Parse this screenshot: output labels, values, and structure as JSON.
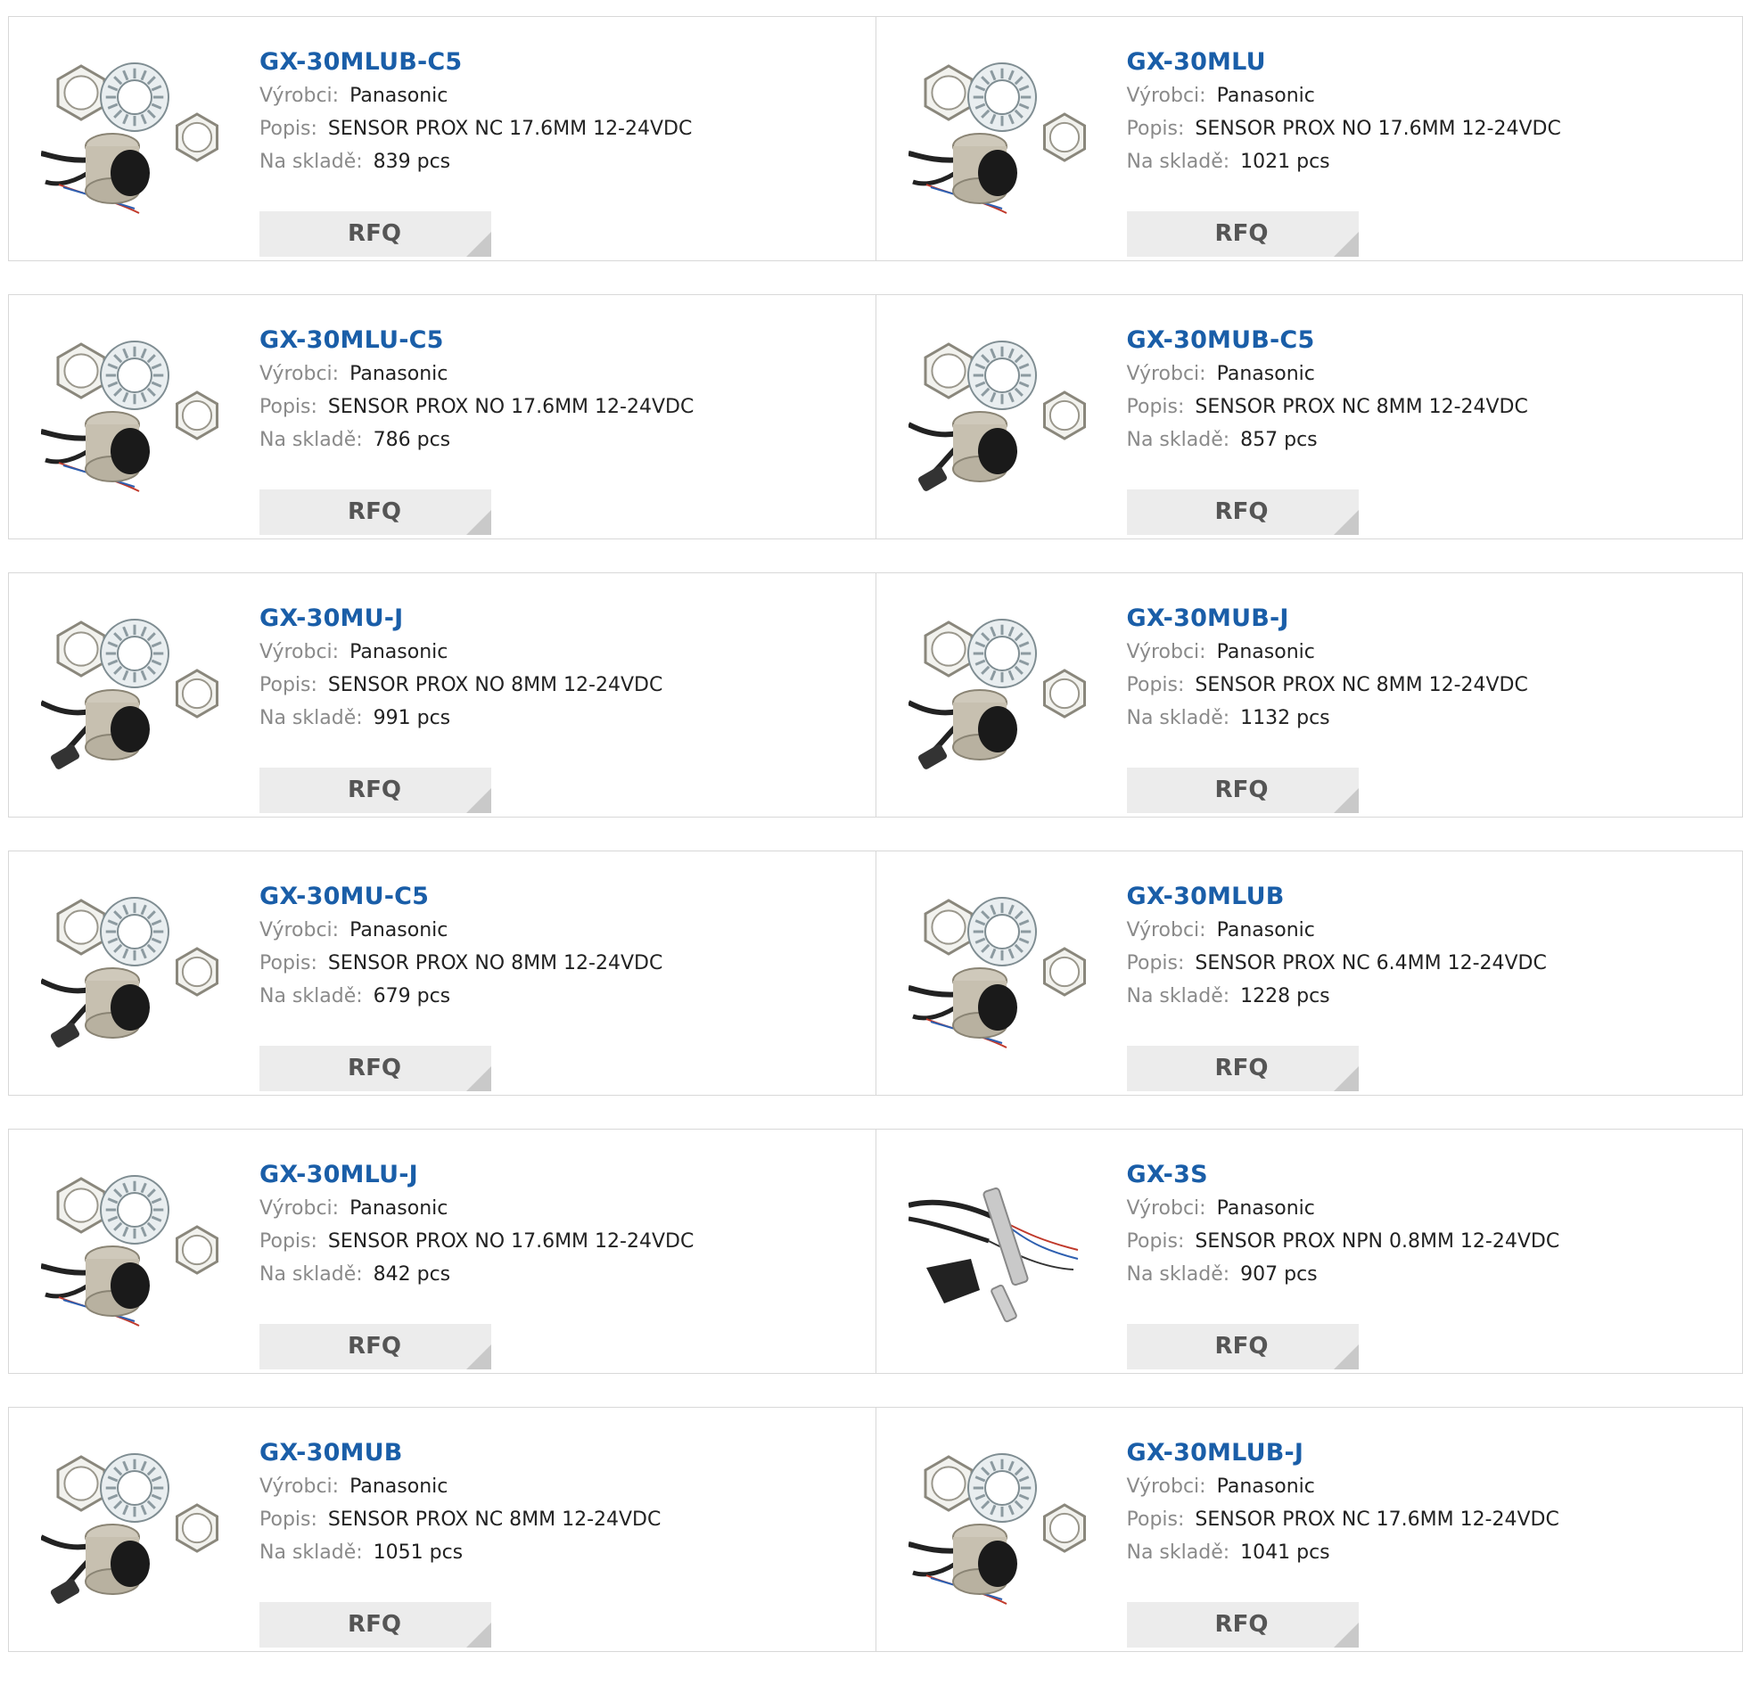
{
  "labels": {
    "manufacturer": "Výrobci:",
    "description": "Popis:",
    "stock": "Na skladě:",
    "rfq": "RFQ"
  },
  "colors": {
    "link": "#1a5ea8",
    "label": "#8a8a8a",
    "button_bg": "#ececec"
  },
  "products": [
    {
      "part": "GX-30MLUB-C5",
      "manufacturer": "Panasonic",
      "description": "SENSOR PROX NC 17.6MM 12-24VDC",
      "stock": "839 pcs",
      "image": "cylinder-sensor-wire-icon"
    },
    {
      "part": "GX-30MLU",
      "manufacturer": "Panasonic",
      "description": "SENSOR PROX NO 17.6MM 12-24VDC",
      "stock": "1021 pcs",
      "image": "cylinder-sensor-wire-icon"
    },
    {
      "part": "GX-30MLU-C5",
      "manufacturer": "Panasonic",
      "description": "SENSOR PROX NO 17.6MM 12-24VDC",
      "stock": "786 pcs",
      "image": "cylinder-sensor-wire-icon"
    },
    {
      "part": "GX-30MUB-C5",
      "manufacturer": "Panasonic",
      "description": "SENSOR PROX NC 8MM 12-24VDC",
      "stock": "857 pcs",
      "image": "cylinder-sensor-connector-icon"
    },
    {
      "part": "GX-30MU-J",
      "manufacturer": "Panasonic",
      "description": "SENSOR PROX NO 8MM 12-24VDC",
      "stock": "991 pcs",
      "image": "cylinder-sensor-connector-icon"
    },
    {
      "part": "GX-30MUB-J",
      "manufacturer": "Panasonic",
      "description": "SENSOR PROX NC 8MM 12-24VDC",
      "stock": "1132 pcs",
      "image": "cylinder-sensor-connector-icon"
    },
    {
      "part": "GX-30MU-C5",
      "manufacturer": "Panasonic",
      "description": "SENSOR PROX NO 8MM 12-24VDC",
      "stock": "679 pcs",
      "image": "cylinder-sensor-connector-icon"
    },
    {
      "part": "GX-30MLUB",
      "manufacturer": "Panasonic",
      "description": "SENSOR PROX NC 6.4MM 12-24VDC",
      "stock": "1228 pcs",
      "image": "cylinder-sensor-wire-icon"
    },
    {
      "part": "GX-30MLU-J",
      "manufacturer": "Panasonic",
      "description": "SENSOR PROX NO 17.6MM 12-24VDC",
      "stock": "842 pcs",
      "image": "cylinder-sensor-wire-icon"
    },
    {
      "part": "GX-3S",
      "manufacturer": "Panasonic",
      "description": "SENSOR PROX NPN 0.8MM 12-24VDC",
      "stock": "907 pcs",
      "image": "rod-sensor-icon"
    },
    {
      "part": "GX-30MUB",
      "manufacturer": "Panasonic",
      "description": "SENSOR PROX NC 8MM 12-24VDC",
      "stock": "1051 pcs",
      "image": "cylinder-sensor-connector-icon"
    },
    {
      "part": "GX-30MLUB-J",
      "manufacturer": "Panasonic",
      "description": "SENSOR PROX NC 17.6MM 12-24VDC",
      "stock": "1041 pcs",
      "image": "cylinder-sensor-wire-icon"
    }
  ]
}
